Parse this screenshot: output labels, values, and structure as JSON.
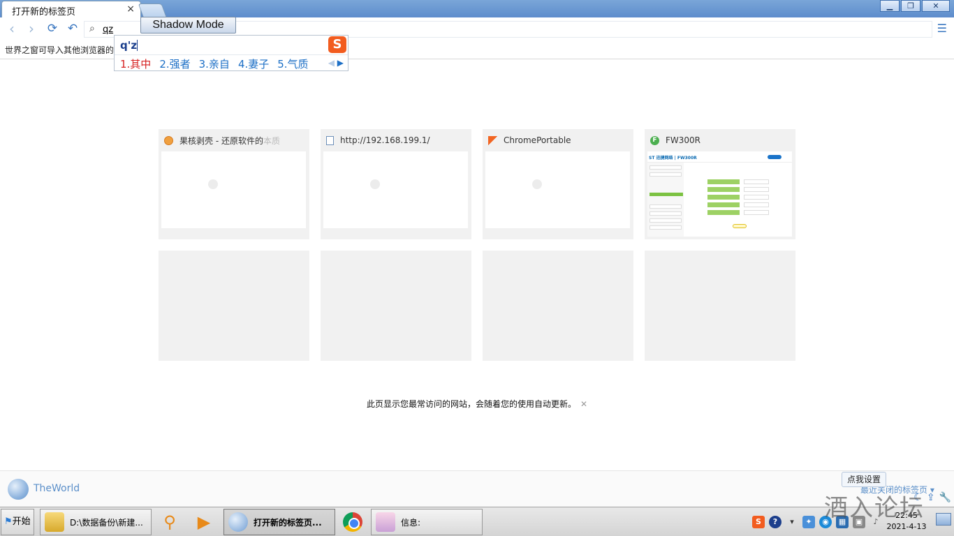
{
  "window": {
    "tab_title": "打开新的标签页",
    "tab_close": "×",
    "min": "▁",
    "restore": "❐",
    "close": "✕"
  },
  "toolbar": {
    "back": "‹",
    "forward": "›",
    "refresh": "⟳",
    "undo": "↶",
    "search_icon": "🔍",
    "address_value": "qz",
    "menu_icon": "☰"
  },
  "bookmark_bar": {
    "text": "世界之窗可导入其他浏览器的"
  },
  "shadow_mode": "Shadow Mode",
  "ime": {
    "composition": "q'z",
    "logo": "S",
    "candidates": [
      "1.其中",
      "2.强者",
      "3.亲自",
      "4.妻子",
      "5.气质"
    ],
    "prev": "◀",
    "next": "▶"
  },
  "speed_dial": {
    "tiles": [
      {
        "title": "果核剥壳 - 还原软件的本质",
        "title_main": "果核剥壳 - 还原软件的",
        "title_fade": "本质",
        "icon": "orange-circle-icon"
      },
      {
        "title": "http://192.168.199.1/",
        "icon": "page-icon"
      },
      {
        "title": "ChromePortable",
        "icon": "chromeportable-icon"
      },
      {
        "title": "FW300R",
        "icon": "fw-icon",
        "fav_letter": "F",
        "brand": "ST 迅捷网络 | FW300R"
      }
    ],
    "note": "此页显示您最常访问的网站，会随着您的使用自动更新。",
    "note_close": "✕"
  },
  "statusbar": {
    "brand": "TheWorld",
    "tip": "点我设置",
    "recent_tabs": "最近关闭的标签页 ▾"
  },
  "taskbar": {
    "start": "开始",
    "tasks": [
      {
        "label": "D:\\数据备份\\新建..."
      },
      {
        "label": "打开新的标签页..."
      },
      {
        "label": "信息:"
      }
    ],
    "clock_time": "22:45",
    "clock_date": "2021-4-13"
  },
  "watermark": "酒入论坛",
  "colors": {
    "accent": "#3a77c0",
    "ime_first": "#d62020",
    "ime_cand": "#1c6fc6",
    "sogou": "#f25c1f"
  }
}
